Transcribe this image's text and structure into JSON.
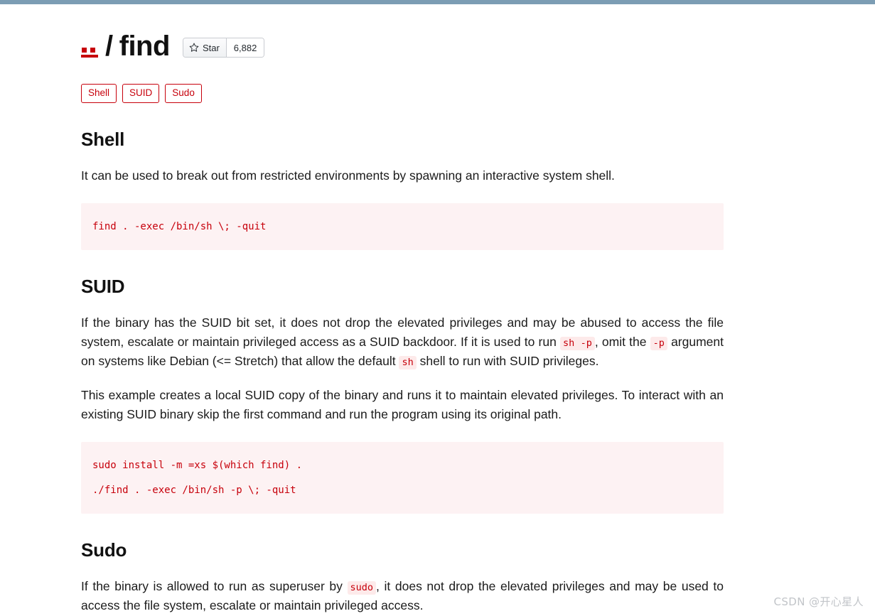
{
  "chrome": {
    "top_bar_color": "#7c9db4"
  },
  "header": {
    "logo_name": "gtfobins-logo",
    "separator": "/",
    "binary_name": "find",
    "star": {
      "icon": "star-icon",
      "label": "Star",
      "count": "6,882"
    }
  },
  "tags": [
    {
      "label": "Shell"
    },
    {
      "label": "SUID"
    },
    {
      "label": "Sudo"
    }
  ],
  "sections": [
    {
      "id": "shell",
      "title": "Shell",
      "paragraphs": [
        "It can be used to break out from restricted environments by spawning an interactive system shell."
      ],
      "code_lines": [
        "find . -exec /bin/sh \\; -quit"
      ]
    },
    {
      "id": "suid",
      "title": "SUID",
      "paragraph_1_part_1": "If the binary has the SUID bit set, it does not drop the elevated privileges and may be abused to access the file system, escalate or maintain privileged access as a SUID backdoor. If it is used to run ",
      "paragraph_1_code_1": "sh -p",
      "paragraph_1_part_2": ", omit the ",
      "paragraph_1_code_2": "-p",
      "paragraph_1_part_3": " argument on systems like Debian (<= Stretch) that allow the default ",
      "paragraph_1_code_3": "sh",
      "paragraph_1_part_4": " shell to run with SUID privileges.",
      "paragraph_2": "This example creates a local SUID copy of the binary and runs it to maintain elevated privileges. To interact with an existing SUID binary skip the first command and run the program using its original path.",
      "code_lines": [
        "sudo install -m =xs $(which find) .",
        "./find . -exec /bin/sh -p \\; -quit"
      ]
    },
    {
      "id": "sudo",
      "title": "Sudo",
      "paragraph_1_part_1": "If the binary is allowed to run as superuser by ",
      "paragraph_1_code_1": "sudo",
      "paragraph_1_part_2": ", it does not drop the elevated privileges and may be used to access the file system, escalate or maintain privileged access."
    }
  ],
  "watermark": {
    "text": "CSDN @开心星人"
  },
  "colors": {
    "accent_red": "#c7000b",
    "code_bg": "#fdf2f3",
    "inline_code_bg": "#fdeaea",
    "top_bar": "#7c9db4"
  }
}
